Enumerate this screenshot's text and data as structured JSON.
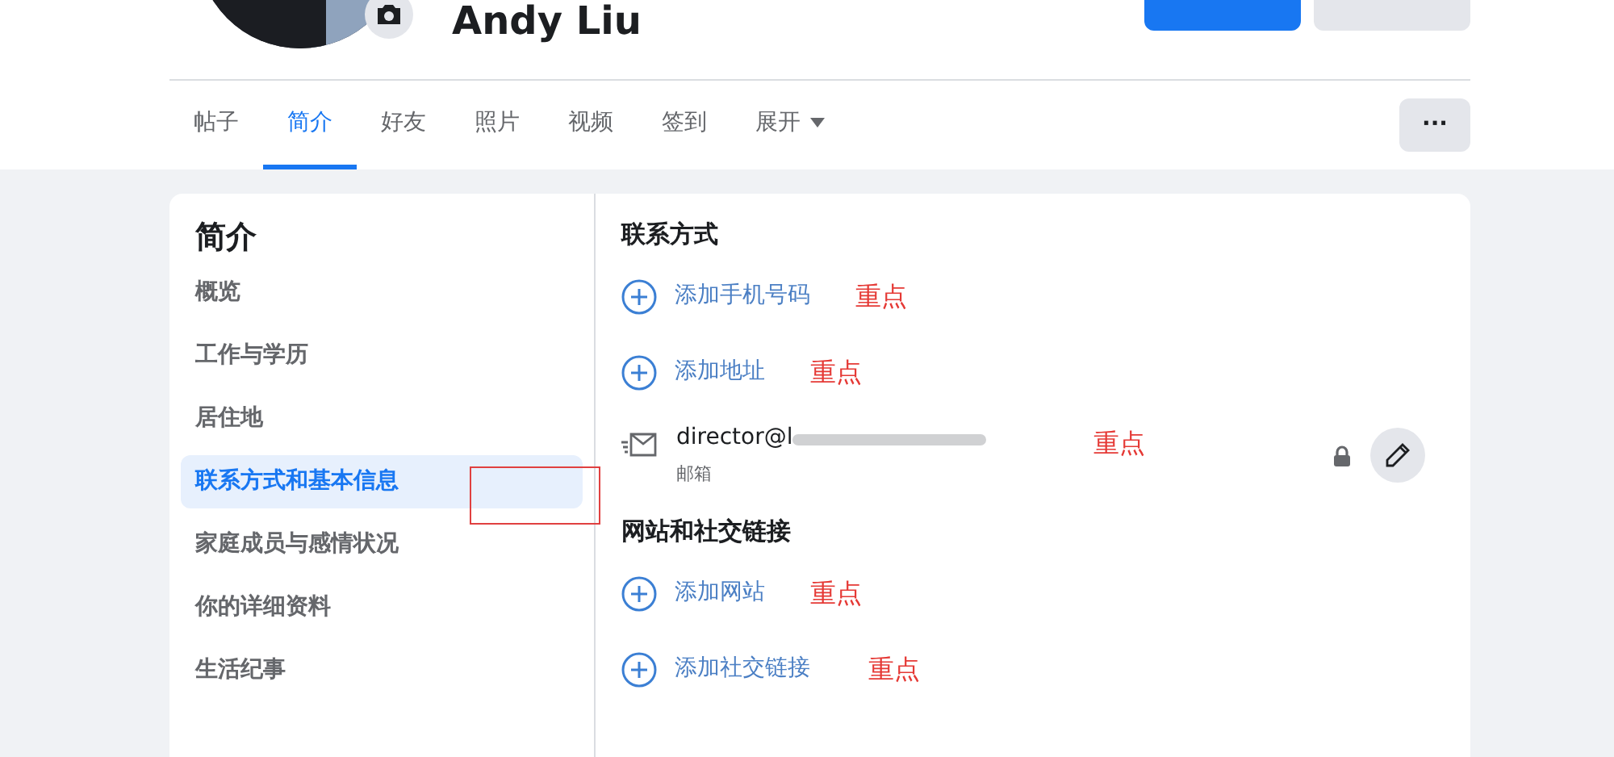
{
  "profile": {
    "name": "Andy Liu"
  },
  "tabs": [
    {
      "label": "帖子",
      "selected": false
    },
    {
      "label": "简介",
      "selected": true
    },
    {
      "label": "好友",
      "selected": false
    },
    {
      "label": "照片",
      "selected": false
    },
    {
      "label": "视频",
      "selected": false
    },
    {
      "label": "签到",
      "selected": false
    },
    {
      "label": "展开",
      "selected": false,
      "kind": "dropdown"
    }
  ],
  "more_button": {
    "label": "···"
  },
  "sidebar": {
    "title": "简介",
    "items": [
      {
        "label": "概览",
        "selected": false
      },
      {
        "label": "工作与学历",
        "selected": false
      },
      {
        "label": "居住地",
        "selected": false
      },
      {
        "label": "联系方式和基本信息",
        "selected": true
      },
      {
        "label": "家庭成员与感情状况",
        "selected": false
      },
      {
        "label": "你的详细资料",
        "selected": false
      },
      {
        "label": "生活纪事",
        "selected": false
      }
    ]
  },
  "sections": [
    {
      "title": "联系方式",
      "items": [
        {
          "kind": "add",
          "label": "添加手机号码",
          "note": "重点"
        },
        {
          "kind": "add",
          "label": "添加地址",
          "note": "重点"
        },
        {
          "kind": "entry",
          "value": "director@l",
          "sublabel": "邮箱",
          "note": "重点"
        }
      ]
    },
    {
      "title": "网站和社交链接",
      "items": [
        {
          "kind": "add",
          "label": "添加网站",
          "note": "重点"
        },
        {
          "kind": "add",
          "label": "添加社交链接",
          "note": "重点"
        }
      ]
    }
  ]
}
